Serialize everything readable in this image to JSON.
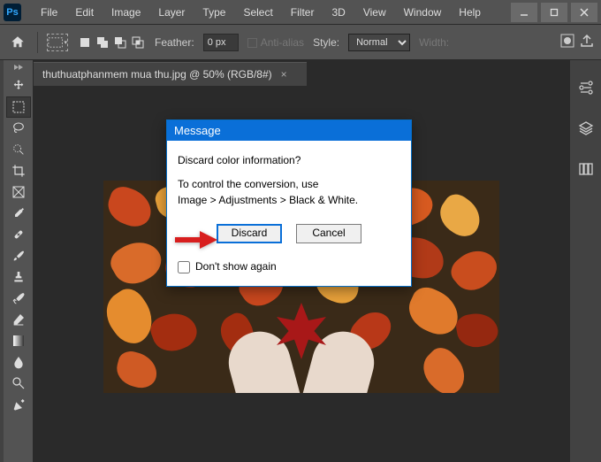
{
  "app": {
    "logo_text": "Ps"
  },
  "menu": [
    "File",
    "Edit",
    "Image",
    "Layer",
    "Type",
    "Select",
    "Filter",
    "3D",
    "View",
    "Window",
    "Help"
  ],
  "options": {
    "feather_label": "Feather:",
    "feather_value": "0 px",
    "anti_alias": "Anti-alias",
    "style_label": "Style:",
    "style_value": "Normal",
    "width_label": "Width:"
  },
  "document": {
    "tab_title": "thuthuatphanmem mua thu.jpg @ 50% (RGB/8#)"
  },
  "dialog": {
    "title": "Message",
    "question": "Discard color information?",
    "hint_line1": "To control the conversion, use",
    "hint_line2": "Image > Adjustments > Black & White.",
    "btn_discard": "Discard",
    "btn_cancel": "Cancel",
    "checkbox": "Don't show again"
  }
}
